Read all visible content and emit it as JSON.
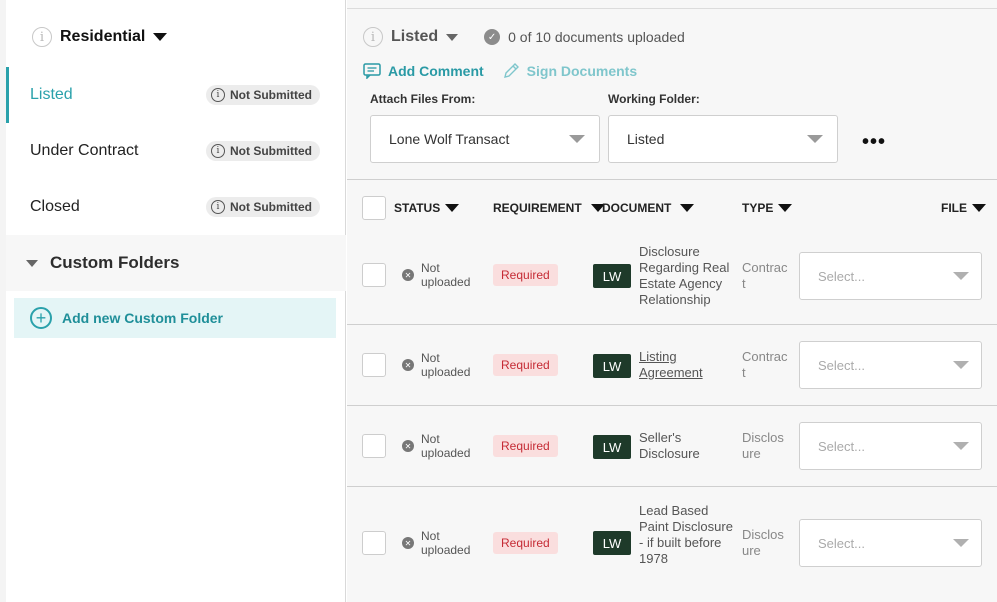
{
  "sidebar": {
    "title": "Residential",
    "folders": [
      {
        "label": "Listed",
        "badge": "Not Submitted"
      },
      {
        "label": "Under Contract",
        "badge": "Not Submitted"
      },
      {
        "label": "Closed",
        "badge": "Not Submitted"
      }
    ],
    "custom_folders_label": "Custom Folders",
    "add_custom_folder_label": "Add new Custom Folder"
  },
  "main": {
    "title": "Listed",
    "upload_status": "0 of 10 documents uploaded",
    "add_comment_label": "Add Comment",
    "sign_documents_label": "Sign Documents",
    "attach_files_label": "Attach Files From:",
    "attach_files_value": "Lone Wolf Transact",
    "working_folder_label": "Working Folder:",
    "working_folder_value": "Listed",
    "more_label": "•••"
  },
  "table": {
    "headers": {
      "status": "STATUS",
      "requirement": "REQUIREMENT",
      "document": "DOCUMENT",
      "type": "TYPE",
      "file": "FILE"
    },
    "rows": [
      {
        "status": "Not uploaded",
        "requirement": "Required",
        "source": "LW",
        "document": "Disclosure Regarding Real Estate Agency Relationship",
        "type": "Contract",
        "file_placeholder": "Select..."
      },
      {
        "status": "Not uploaded",
        "requirement": "Required",
        "source": "LW",
        "document": "Listing Agreement",
        "type": "Contract",
        "file_placeholder": "Select..."
      },
      {
        "status": "Not uploaded",
        "requirement": "Required",
        "source": "LW",
        "document": "Seller's Disclosure",
        "type": "Disclosure",
        "file_placeholder": "Select..."
      },
      {
        "status": "Not uploaded",
        "requirement": "Required",
        "source": "LW",
        "document": "Lead Based Paint Disclosure - if built before 1978",
        "type": "Disclosure",
        "file_placeholder": "Select..."
      }
    ]
  },
  "colors": {
    "accent": "#2aa1ab",
    "required_bg": "#fadede",
    "required_text": "#c52b35",
    "lw_badge": "#1e3a2a"
  }
}
